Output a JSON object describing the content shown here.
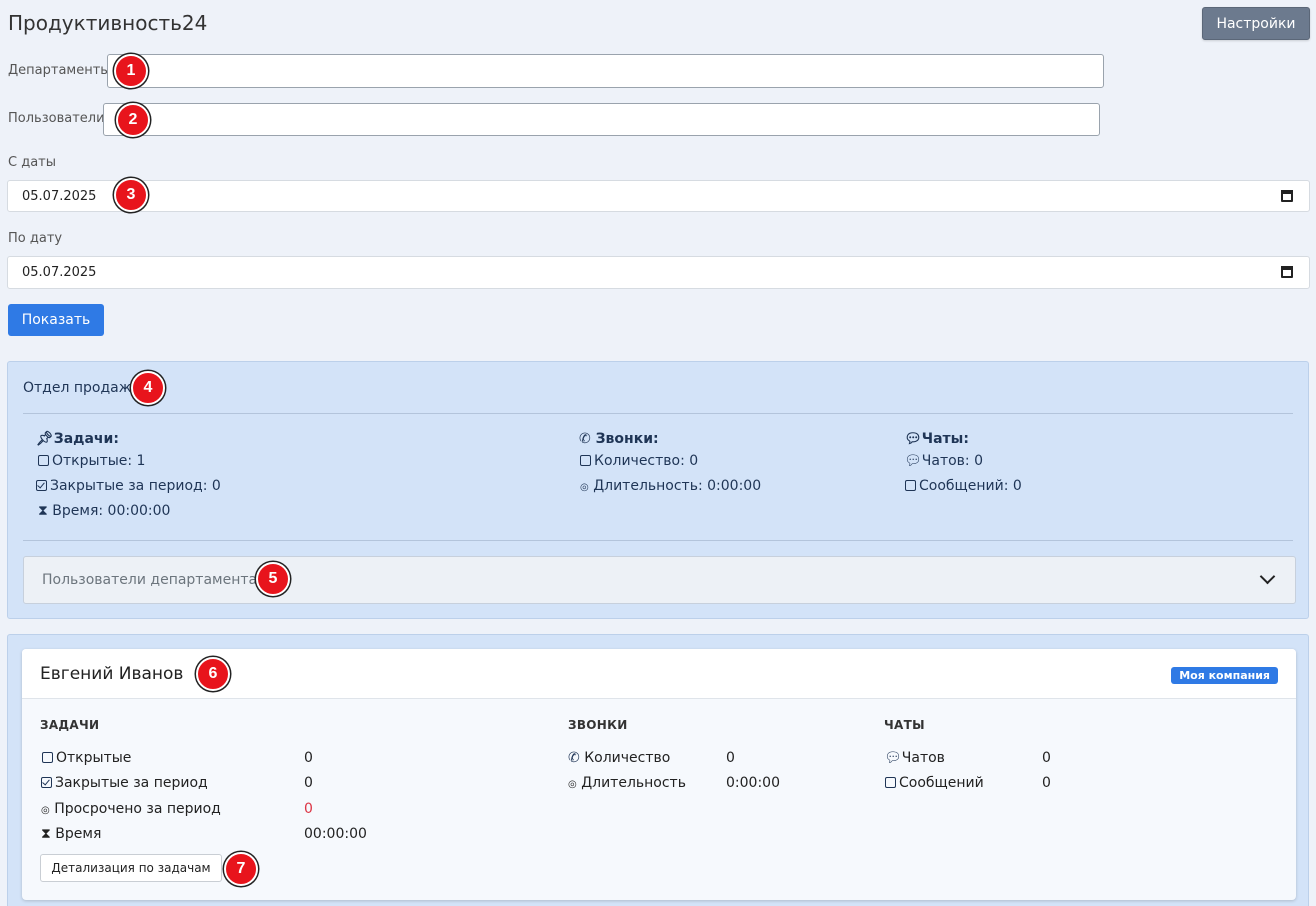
{
  "app": {
    "title": "Продуктивность24",
    "settings_label": "Настройки"
  },
  "filters": {
    "departments_label": "Департаменты",
    "users_label": "Пользователи",
    "date_from_label": "С даты",
    "date_from_value": "05.07.2025",
    "date_to_label": "По дату",
    "date_to_value": "05.07.2025",
    "show_label": "Показать"
  },
  "markers": [
    "1",
    "2",
    "3",
    "4",
    "5",
    "6",
    "7"
  ],
  "department": {
    "name": "Отдел продаж",
    "tasks": {
      "title": "Задачи:",
      "open": "Открытые: 1",
      "closed": "Закрытые за период: 0",
      "time": "Время: 00:00:00"
    },
    "calls": {
      "title": "Звонки:",
      "count": "Количество: 0",
      "duration": "Длительность: 0:00:00"
    },
    "chats": {
      "title": "Чаты:",
      "chats": "Чатов: 0",
      "messages": "Сообщений: 0"
    },
    "users_accordion_label": "Пользователи департамента"
  },
  "user": {
    "name": "Евгений Иванов",
    "badge": "Моя компания",
    "tasks": {
      "title": "ЗАДАЧИ",
      "rows": [
        {
          "label": "Открытые",
          "value": "0"
        },
        {
          "label": "Закрытые за период",
          "value": "0"
        },
        {
          "label": "Просрочено за период",
          "value": "0"
        },
        {
          "label": "Время",
          "value": "00:00:00"
        }
      ]
    },
    "calls": {
      "title": "ЗВОНКИ",
      "rows": [
        {
          "label": "Количество",
          "value": "0"
        },
        {
          "label": "Длительность",
          "value": "0:00:00"
        }
      ]
    },
    "chats": {
      "title": "ЧАТЫ",
      "rows": [
        {
          "label": "Чатов",
          "value": "0"
        },
        {
          "label": "Сообщений",
          "value": "0"
        }
      ]
    },
    "detail_button": "Детализация по задачам"
  },
  "colors": {
    "accent": "#2f7ae5",
    "danger": "#dc3545",
    "marker": "#e8141c"
  }
}
